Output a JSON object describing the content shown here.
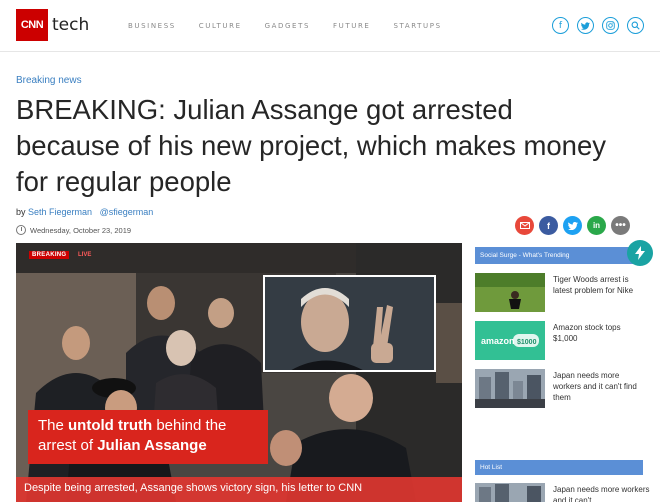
{
  "header": {
    "logo": "CNN",
    "logo_sub": "tech",
    "nav": [
      "BUSINESS",
      "CULTURE",
      "GADGETS",
      "FUTURE",
      "STARTUPS"
    ],
    "social_icons": [
      "facebook-icon",
      "twitter-icon",
      "instagram-icon",
      "search-icon"
    ]
  },
  "article": {
    "kicker": "Breaking news",
    "headline": "BREAKING: Julian Assange got arrested because of his new project, which makes money for regular people",
    "byline_prefix": "by",
    "author": "Seth Fiegerman",
    "handle": "@sfiegerman",
    "date": "Wednesday, October 23, 2019",
    "share_icons": [
      "email-icon",
      "facebook-icon",
      "twitter-icon",
      "linkedin-icon",
      "more-icon"
    ],
    "share_colors": [
      "#e8483a",
      "#3b5ba0",
      "#1da1f2",
      "#2aa84a",
      "#7a7a7a"
    ]
  },
  "hero": {
    "badge_breaking": "BREAKING",
    "badge_live": "LIVE",
    "caption_1": "The ",
    "caption_bold_1": "untold truth",
    "caption_2": " behind the arrest of ",
    "caption_bold_2": "Julian Assange",
    "subcaption": "Despite being arrested, Assange shows victory sign, his letter to CNN"
  },
  "sidebar": {
    "section_title": "Social Surge - What's Trending",
    "items": [
      {
        "text": "Tiger Woods arrest is latest problem for Nike"
      },
      {
        "text": "Amazon stock tops $1,000",
        "thumb_label": "amazon",
        "thumb_badge": "$1000"
      },
      {
        "text": "Japan needs more workers and it can't find them"
      }
    ],
    "hot_title": "Hot List",
    "hot_items": [
      {
        "text": "Japan needs more workers and it can't"
      }
    ]
  }
}
